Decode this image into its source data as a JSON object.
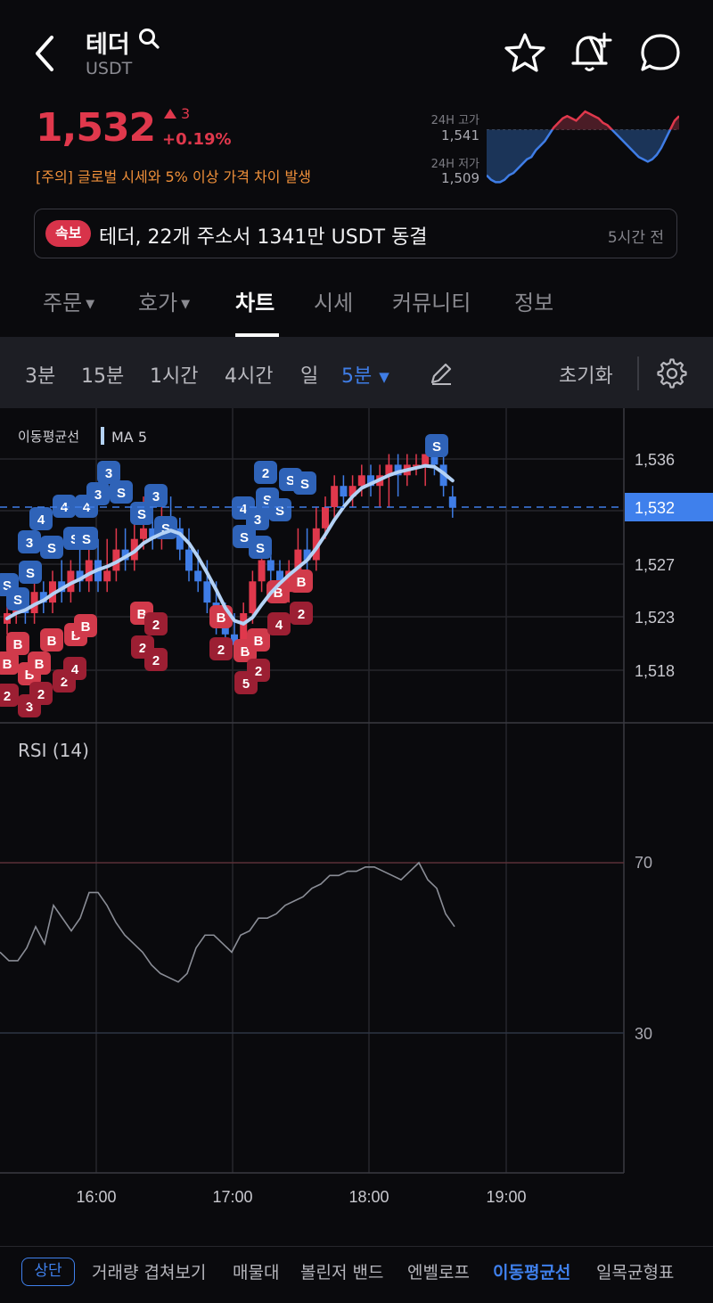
{
  "header": {
    "title": "테더",
    "symbol": "USDT",
    "price": "1,532",
    "change_value": "3",
    "change_pct": "+0.19%",
    "warning": "[주의] 글로벌 시세와 5% 이상 가격 차이 발생",
    "high_label": "24H 고가",
    "high_value": "1,541",
    "low_label": "24H 저가",
    "low_value": "1,509",
    "icons": [
      "back-arrow-icon",
      "search-icon",
      "star-icon",
      "bell-plus-icon",
      "chat-bubble-icon"
    ]
  },
  "news": {
    "badge": "속보",
    "text": "테더, 22개 주소서 1341만 USDT 동결",
    "time": "5시간 전"
  },
  "tabs": [
    {
      "label": "주문",
      "dropdown": true
    },
    {
      "label": "호가",
      "dropdown": true
    },
    {
      "label": "차트",
      "active": true
    },
    {
      "label": "시세"
    },
    {
      "label": "커뮤니티"
    },
    {
      "label": "정보"
    }
  ],
  "toolbar": {
    "intervals": [
      "3분",
      "15분",
      "1시간",
      "4시간",
      "일"
    ],
    "selected_interval": "5분",
    "reset_label": "초기화"
  },
  "main_chart": {
    "legend_group": "이동평균선",
    "legend_ma": "MA 5",
    "y_ticks": [
      "1,536",
      "1,527",
      "1,523",
      "1,518"
    ],
    "current_price": "1,532"
  },
  "rsi_chart": {
    "title": "RSI (14)",
    "y_ticks": [
      "70",
      "30"
    ]
  },
  "x_ticks": [
    "16:00",
    "17:00",
    "18:00",
    "19:00"
  ],
  "bottom_bar": {
    "top_button": "상단",
    "items": [
      "거래량 겹쳐보기",
      "매물대",
      "볼린저 밴드",
      "엔벨로프",
      "이동평균선",
      "일목균형표"
    ],
    "selected": "이동평균선"
  },
  "colors": {
    "up": "#e0384c",
    "down": "#3f7de6",
    "ma_line": "#b4d2f5",
    "warning": "#f0903a"
  },
  "chart_data": {
    "type": "candlestick",
    "y_range": [
      1514,
      1540
    ],
    "candles": [
      {
        "o": 1521,
        "c": 1522,
        "h": 1523,
        "l": 1520
      },
      {
        "o": 1522,
        "c": 1523,
        "h": 1524,
        "l": 1521
      },
      {
        "o": 1523,
        "c": 1522,
        "h": 1524,
        "l": 1521
      },
      {
        "o": 1522,
        "c": 1524,
        "h": 1525,
        "l": 1521
      },
      {
        "o": 1524,
        "c": 1523,
        "h": 1525,
        "l": 1522
      },
      {
        "o": 1523,
        "c": 1525,
        "h": 1526,
        "l": 1522
      },
      {
        "o": 1525,
        "c": 1524,
        "h": 1527,
        "l": 1523
      },
      {
        "o": 1524,
        "c": 1526,
        "h": 1527,
        "l": 1523
      },
      {
        "o": 1526,
        "c": 1525,
        "h": 1528,
        "l": 1524
      },
      {
        "o": 1525,
        "c": 1527,
        "h": 1528,
        "l": 1524
      },
      {
        "o": 1527,
        "c": 1525,
        "h": 1529,
        "l": 1524
      },
      {
        "o": 1525,
        "c": 1526,
        "h": 1529,
        "l": 1524
      },
      {
        "o": 1526,
        "c": 1528,
        "h": 1530,
        "l": 1525
      },
      {
        "o": 1528,
        "c": 1527,
        "h": 1530,
        "l": 1526
      },
      {
        "o": 1527,
        "c": 1529,
        "h": 1531,
        "l": 1526
      },
      {
        "o": 1529,
        "c": 1530,
        "h": 1533,
        "l": 1528
      },
      {
        "o": 1530,
        "c": 1529,
        "h": 1533,
        "l": 1528
      },
      {
        "o": 1529,
        "c": 1531,
        "h": 1532,
        "l": 1528
      },
      {
        "o": 1531,
        "c": 1530,
        "h": 1533,
        "l": 1529
      },
      {
        "o": 1530,
        "c": 1528,
        "h": 1531,
        "l": 1527
      },
      {
        "o": 1528,
        "c": 1526,
        "h": 1530,
        "l": 1525
      },
      {
        "o": 1526,
        "c": 1525,
        "h": 1528,
        "l": 1524
      },
      {
        "o": 1525,
        "c": 1523,
        "h": 1527,
        "l": 1522
      },
      {
        "o": 1523,
        "c": 1521,
        "h": 1525,
        "l": 1520
      },
      {
        "o": 1521,
        "c": 1520,
        "h": 1523,
        "l": 1519
      },
      {
        "o": 1520,
        "c": 1519,
        "h": 1522,
        "l": 1518
      },
      {
        "o": 1519,
        "c": 1522,
        "h": 1523,
        "l": 1518
      },
      {
        "o": 1522,
        "c": 1525,
        "h": 1526,
        "l": 1521
      },
      {
        "o": 1525,
        "c": 1527,
        "h": 1528,
        "l": 1524
      },
      {
        "o": 1527,
        "c": 1526,
        "h": 1528,
        "l": 1524
      },
      {
        "o": 1526,
        "c": 1524,
        "h": 1527,
        "l": 1523
      },
      {
        "o": 1524,
        "c": 1526,
        "h": 1527,
        "l": 1523
      },
      {
        "o": 1526,
        "c": 1528,
        "h": 1530,
        "l": 1525
      },
      {
        "o": 1528,
        "c": 1527,
        "h": 1530,
        "l": 1526
      },
      {
        "o": 1527,
        "c": 1530,
        "h": 1532,
        "l": 1526
      },
      {
        "o": 1530,
        "c": 1532,
        "h": 1533,
        "l": 1529
      },
      {
        "o": 1532,
        "c": 1534,
        "h": 1535,
        "l": 1531
      },
      {
        "o": 1534,
        "c": 1533,
        "h": 1535,
        "l": 1532
      },
      {
        "o": 1533,
        "c": 1534,
        "h": 1535,
        "l": 1532
      },
      {
        "o": 1534,
        "c": 1535,
        "h": 1536,
        "l": 1533
      },
      {
        "o": 1535,
        "c": 1534,
        "h": 1536,
        "l": 1533
      },
      {
        "o": 1534,
        "c": 1535,
        "h": 1536,
        "l": 1532
      },
      {
        "o": 1535,
        "c": 1536,
        "h": 1537,
        "l": 1532
      },
      {
        "o": 1536,
        "c": 1535,
        "h": 1537,
        "l": 1533
      },
      {
        "o": 1535,
        "c": 1536,
        "h": 1537,
        "l": 1534
      },
      {
        "o": 1536,
        "c": 1536,
        "h": 1537,
        "l": 1535
      },
      {
        "o": 1536,
        "c": 1537,
        "h": 1537,
        "l": 1534
      },
      {
        "o": 1537,
        "c": 1536,
        "h": 1538,
        "l": 1535
      },
      {
        "o": 1536,
        "c": 1534,
        "h": 1537,
        "l": 1533
      },
      {
        "o": 1533,
        "c": 1532,
        "h": 1534,
        "l": 1531
      }
    ],
    "ma5": [
      1521.5,
      1522,
      1522.3,
      1522.8,
      1523.2,
      1523.8,
      1524.3,
      1524.8,
      1525.2,
      1525.7,
      1526.1,
      1526.4,
      1526.8,
      1527.3,
      1527.8,
      1528.6,
      1529.1,
      1529.5,
      1529.8,
      1529.5,
      1528.6,
      1527.3,
      1525.8,
      1524.2,
      1522.5,
      1521.3,
      1521,
      1521.6,
      1522.8,
      1523.9,
      1524.8,
      1525.6,
      1526.3,
      1527,
      1528.1,
      1529.4,
      1530.8,
      1532,
      1533,
      1533.8,
      1534.2,
      1534.6,
      1535,
      1535.3,
      1535.5,
      1535.7,
      1535.9,
      1535.8,
      1535.2,
      1534.5
    ],
    "rsi": [
      49,
      47,
      47,
      50,
      55,
      51,
      60,
      57,
      54,
      57,
      63,
      63,
      60,
      56,
      53,
      51,
      49,
      46,
      44,
      43,
      42,
      44,
      50,
      53,
      53,
      51,
      49,
      53,
      54,
      57,
      57,
      58,
      60,
      61,
      62,
      64,
      65,
      67,
      67,
      68,
      68,
      69,
      69,
      68,
      67,
      66,
      68,
      70,
      66,
      64,
      58,
      55
    ],
    "rsi_levels": [
      70,
      30
    ],
    "mini_24h": [
      1512,
      1510,
      1509,
      1509,
      1510,
      1512,
      1513,
      1515,
      1517,
      1519,
      1520,
      1523,
      1525,
      1527,
      1530,
      1533,
      1535,
      1537,
      1538,
      1537,
      1536,
      1538,
      1540,
      1539,
      1538,
      1537,
      1535,
      1534,
      1532,
      1530,
      1528,
      1526,
      1524,
      1522,
      1520,
      1519,
      1518,
      1519,
      1521,
      1524,
      1528,
      1532,
      1536,
      1538
    ],
    "mini_ref": 1532,
    "x_ticks": [
      "16:00",
      "17:00",
      "18:00",
      "19:00"
    ]
  }
}
